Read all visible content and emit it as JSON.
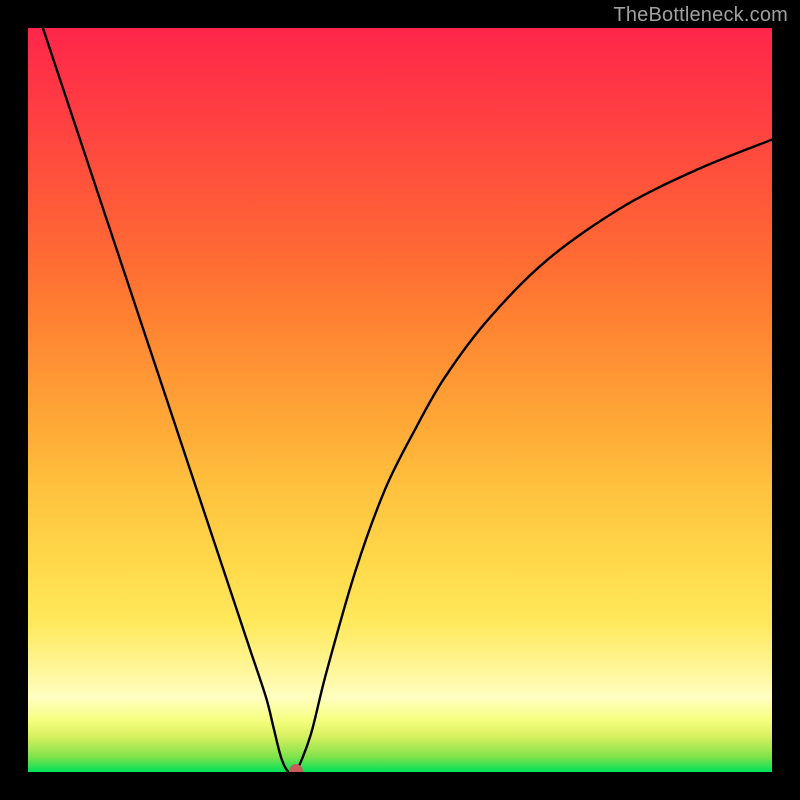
{
  "watermark": "TheBottleneck.com",
  "chart_data": {
    "type": "line",
    "title": "",
    "xlabel": "",
    "ylabel": "",
    "xlim": [
      0,
      100
    ],
    "ylim": [
      0,
      100
    ],
    "grid": false,
    "series": [
      {
        "name": "bottleneck-curve",
        "x": [
          2,
          5,
          10,
          15,
          20,
          25,
          28,
          30,
          32,
          33,
          34,
          35,
          36,
          38,
          40,
          44,
          48,
          52,
          56,
          62,
          70,
          80,
          90,
          100
        ],
        "values": [
          100,
          91,
          76,
          61,
          46,
          31,
          22,
          16,
          10,
          6,
          2,
          0,
          0,
          5,
          13,
          27,
          38,
          46,
          53,
          61,
          69,
          76,
          81,
          85
        ]
      }
    ],
    "annotations": [
      {
        "name": "optimum-marker",
        "x": 36,
        "y": 0
      }
    ],
    "background_gradient": {
      "top": "#ff264a",
      "mid": "#ffd94a",
      "bottom": "#00e05a"
    }
  }
}
